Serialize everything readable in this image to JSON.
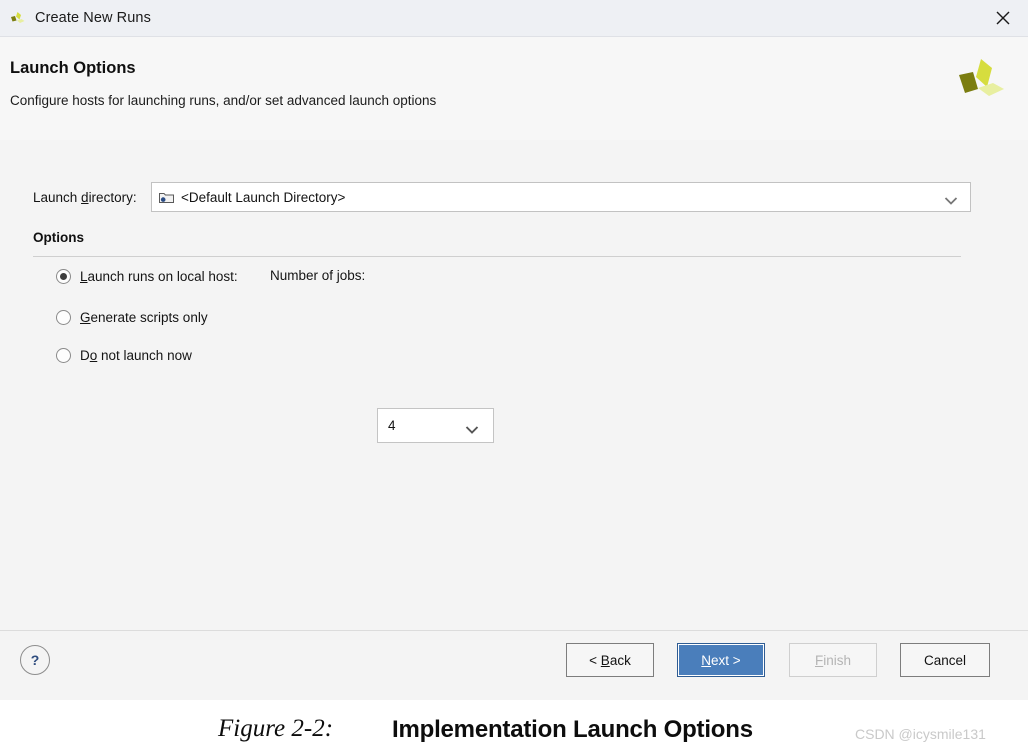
{
  "window": {
    "title": "Create New Runs",
    "app_icon": "xilinx-logo-icon",
    "close_icon": "close-icon"
  },
  "header": {
    "title": "Launch Options",
    "subtitle": "Configure hosts for launching runs, and/or set advanced launch options",
    "logo_icon": "xilinx-logo-icon"
  },
  "launch_directory": {
    "label_pre": "Launch ",
    "label_accel": "d",
    "label_post": "irectory:",
    "label_full": "Launch directory:",
    "value": "<Default Launch Directory>",
    "folder_icon": "folder-icon",
    "dropdown_icon": "chevron-down-icon"
  },
  "options": {
    "group_title": "Options",
    "radios": [
      {
        "id": "launch-local-host",
        "accel": "L",
        "rest": "aunch runs on local host:",
        "label_full": "Launch runs on local host:",
        "selected": true
      },
      {
        "id": "generate-scripts-only",
        "accel": "G",
        "rest": "enerate scripts only",
        "label_full": "Generate scripts only",
        "selected": false
      },
      {
        "id": "do-not-launch-now",
        "pre": "D",
        "accel": "o",
        "rest": " not launch now",
        "label_full": "Do not launch now",
        "selected": false
      }
    ],
    "jobs": {
      "label": "Number of jobs:",
      "value": "4",
      "dropdown_icon": "chevron-down-icon"
    }
  },
  "footer": {
    "help_label": "?",
    "buttons": [
      {
        "id": "back",
        "pre": "< ",
        "accel": "B",
        "rest": "ack",
        "label_full": "< Back",
        "state": "enabled"
      },
      {
        "id": "next",
        "pre": "",
        "accel": "N",
        "rest": "ext >",
        "label_full": "Next >",
        "state": "default"
      },
      {
        "id": "finish",
        "pre": "",
        "accel": "F",
        "rest": "inish",
        "label_full": "Finish",
        "state": "disabled"
      },
      {
        "id": "cancel",
        "pre": "",
        "accel": "",
        "rest": "Cancel",
        "label_full": "Cancel",
        "state": "enabled"
      }
    ]
  },
  "caption": {
    "figure_number": "Figure 2-2:",
    "figure_title": "Implementation Launch Options",
    "watermark": "CSDN @icysmile131"
  },
  "colors": {
    "accent_blue": "#4a7ebb",
    "logo_dark": "#7b7d10",
    "logo_mid": "#d6dd3e",
    "logo_light": "#e8efa0",
    "titlebar_bg": "#eef0f4",
    "dialog_bg": "#f4f4f4",
    "help_blue": "#2e4c7e"
  }
}
